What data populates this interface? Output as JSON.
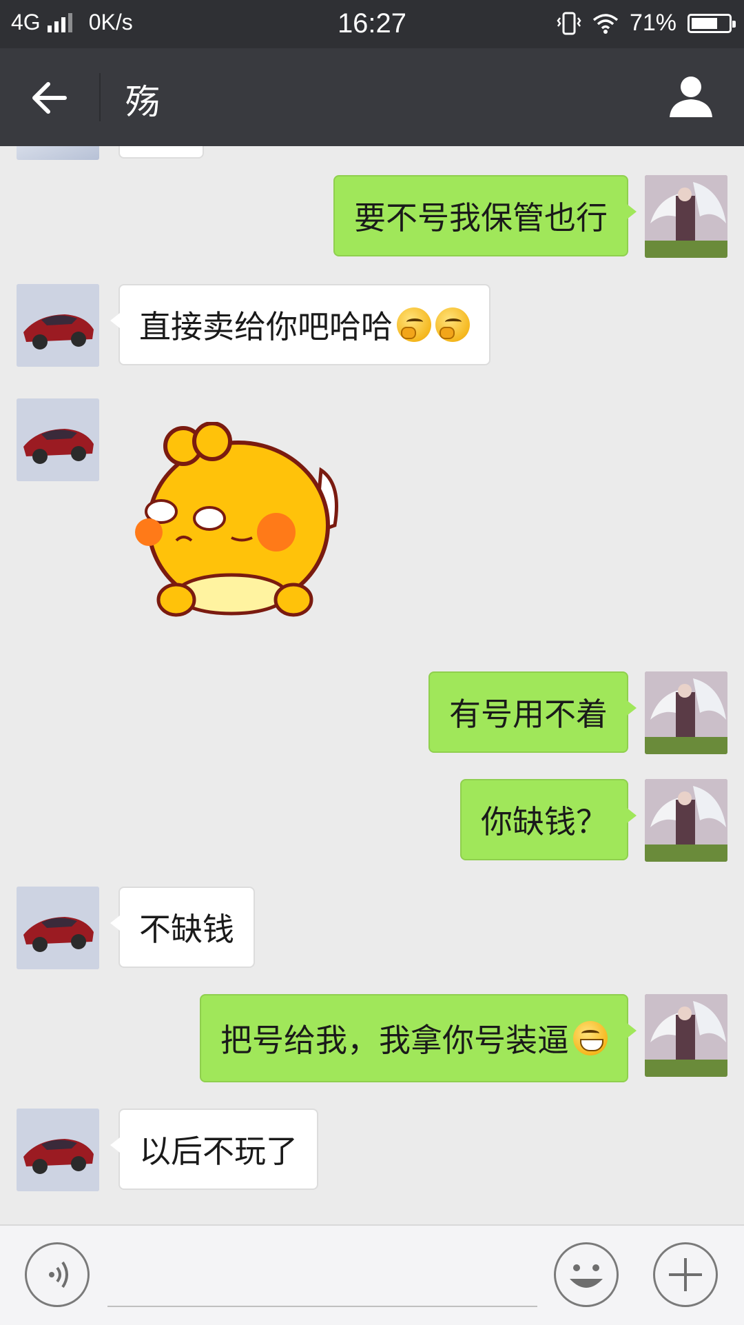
{
  "status": {
    "network": "4G",
    "speed": "0K/s",
    "time": "16:27",
    "battery": "71%",
    "battery_level": 0.71
  },
  "header": {
    "title": "殇",
    "back_icon": "arrow-left-icon",
    "profile_icon": "person-icon"
  },
  "messages": [
    {
      "from": "me",
      "text": "要不号我保管也行"
    },
    {
      "from": "them",
      "text": "直接卖给你吧哈哈",
      "emoji": [
        "thinking-emoji",
        "thinking-emoji"
      ]
    },
    {
      "from": "them",
      "type": "sticker",
      "sticker": "yellow-chick-sticker"
    },
    {
      "from": "me",
      "text": "有号用不着"
    },
    {
      "from": "me",
      "text": "你缺钱？"
    },
    {
      "from": "them",
      "text": "不缺钱"
    },
    {
      "from": "me",
      "text": "把号给我，我拿你号装逼",
      "emoji": [
        "grin-emoji"
      ]
    },
    {
      "from": "them",
      "text": "以后不玩了"
    }
  ],
  "input": {
    "voice_icon": "voice-icon",
    "emoji_icon": "smiley-icon",
    "more_icon": "plus-icon"
  },
  "colors": {
    "header_bg": "#393a3f",
    "status_bg": "#2f3034",
    "chat_bg": "#ebebeb",
    "my_bubble": "#a0e75a",
    "their_bubble": "#ffffff"
  }
}
